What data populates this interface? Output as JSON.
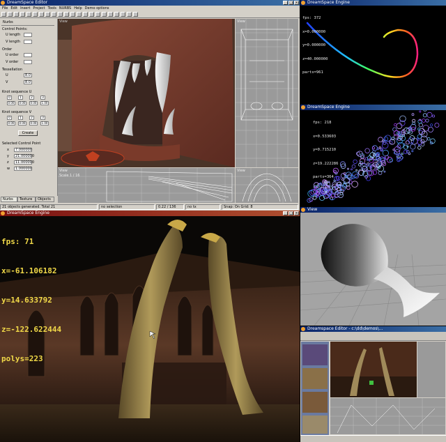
{
  "editor": {
    "title": "DreamSpace Editor",
    "menu": [
      "File",
      "Edit",
      "Insert",
      "Project",
      "Tools",
      "NURBS",
      "Help",
      "Demo options"
    ],
    "panel": {
      "section_title": "Nurbs",
      "control_points_label": "Control Points:",
      "u_length_label": "U length",
      "v_length_label": "V length",
      "order_label": "Order",
      "u_order_label": "U order",
      "v_order_label": "V order",
      "tessellation_label": "Tessellation",
      "u_label": "U",
      "v_label": "V",
      "u_tess": "8.0",
      "v_tess": "8.0",
      "knot_u_label": "Knot sequence U",
      "knot_v_label": "Knot sequence V",
      "knot_u_index": [
        "0",
        "1",
        "2",
        "3"
      ],
      "knot_u_values": [
        "0.00",
        "0.00",
        "0.00",
        "1.00"
      ],
      "knot_v_index": [
        "0",
        "1",
        "2",
        "3"
      ],
      "knot_v_values": [
        "0.00",
        "0.00",
        "0.00",
        "1.00"
      ],
      "create_label": "Create",
      "selected_cp_label": "Selected Control Point",
      "x_label": "x",
      "y_label": "y",
      "z_label": "z",
      "w_label": "w",
      "x_value": "7.000000",
      "y_value": "21.000000",
      "z_value": "11.000000",
      "w_value": "1.000000"
    },
    "tabs": [
      "Nurbs",
      "Texture",
      "Objects"
    ],
    "viewports": {
      "main_label": "View",
      "top_right_label": "View",
      "bottom_left_label": "View",
      "bottom_left_scale": "Scale 1 / 16",
      "bottom_right_label": "View"
    },
    "status": {
      "objects": "21 objects generated. Total 21",
      "selection": "no selection",
      "coords": "0.22 / 136",
      "mode": "no tx",
      "snap": "Snap: On  Grid: 8"
    }
  },
  "curve_window": {
    "title": "DreamSpace Engine",
    "hud": [
      "fps: 372",
      "x=0.000000",
      "y=0.000000",
      "z=40.000000",
      "parts=961"
    ],
    "hud_color": "#e8e8e8"
  },
  "particle_window": {
    "title": "DreamSpace Engine",
    "hud": [
      "fps: 218",
      "x=0.533603",
      "y=0.715210",
      "z=19.222286",
      "parts=364"
    ],
    "hud_color": "#e8e8e8"
  },
  "engine_window": {
    "title": "DreamSpace Engine",
    "hud": [
      "fps: 71",
      "x=-61.106182",
      "y=14.633792",
      "z=-122.622444",
      "polys=223"
    ],
    "hud_color": "#f0d848"
  },
  "goblet_window": {
    "title": "View"
  },
  "mini_editor": {
    "title": "Dreamspace Editor - c:\\dd\\demos\\..."
  },
  "colors": {
    "win_bg": "#d4d0c8",
    "title_blue": "#0a246a",
    "title_red": "#7a1010",
    "viewport_grey": "#9a9a9a"
  }
}
